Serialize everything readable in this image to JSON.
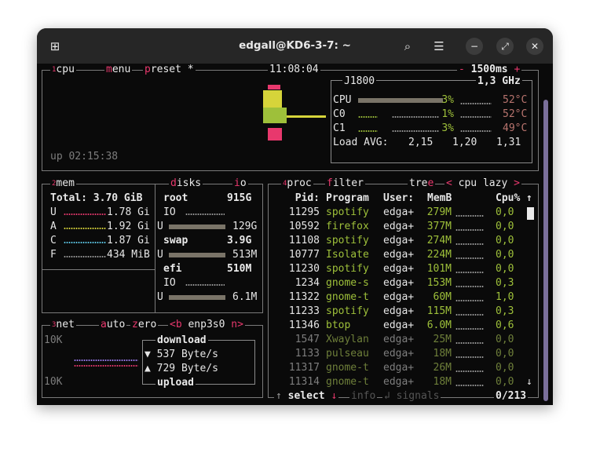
{
  "window": {
    "title": "edgall@KD6-3-7: ~"
  },
  "cpu": {
    "tab_num": "1",
    "tab_label": "cpu",
    "menu": "menu",
    "preset": "preset *",
    "clock": "11:08:04",
    "interval": "1500ms",
    "minus": "-",
    "plus": "+",
    "uptime": "up 02:15:38",
    "model": "J1800",
    "freq": "1,3 GHz",
    "cores": [
      {
        "name": "CPU",
        "pct": "3%",
        "temp": "52°C",
        "load": 0.03
      },
      {
        "name": "C0",
        "pct": "1%",
        "temp": "52°C",
        "load": 0.01
      },
      {
        "name": "C1",
        "pct": "3%",
        "temp": "49°C",
        "load": 0.03
      }
    ],
    "load_avg_label": "Load AVG:",
    "load_avg": [
      "2,15",
      "1,20",
      "1,31"
    ]
  },
  "mem": {
    "tab_num": "2",
    "tab_label": "mem",
    "total": "Total: 3.70 GiB",
    "rows": [
      {
        "key": "U",
        "value": "1.78 Gi",
        "color": "#e8386d"
      },
      {
        "key": "A",
        "value": "1.92 Gi",
        "color": "#d6d43a"
      },
      {
        "key": "C",
        "value": "1.87 Gi",
        "color": "#5ec8e8"
      },
      {
        "key": "F",
        "value": "434 MiB",
        "color": "#9a9a9a"
      }
    ]
  },
  "disks": {
    "tab_label": "disks",
    "io_label": "io",
    "items": [
      {
        "name": "root",
        "size": "915G",
        "io": "IO",
        "u": "U",
        "used": "129G",
        "fill": 0.14
      },
      {
        "name": "swap",
        "size": "3.9G",
        "u": "U",
        "used": "513M",
        "fill": 0.13
      },
      {
        "name": "efi",
        "size": "510M",
        "io": "IO",
        "u": "U",
        "used": "6.1M",
        "fill": 0.01
      }
    ]
  },
  "net": {
    "tab_num": "3",
    "tab_label": "net",
    "auto": "auto",
    "zero": "zero",
    "prev": "<b",
    "iface": "enp3s0",
    "next": "n>",
    "scale_top": "10K",
    "scale_bottom": "10K",
    "download_label": "download",
    "download": "▼ 537 Byte/s",
    "upload": "▲ 729 Byte/s",
    "upload_label": "upload"
  },
  "proc": {
    "tab_num": "4",
    "tab_label": "proc",
    "filter": "filter",
    "tree": "tree",
    "sort_prev": "<",
    "sort": "cpu lazy",
    "sort_next": ">",
    "headers": {
      "pid": "Pid:",
      "program": "Program",
      "user": "User:",
      "mem": "MemB",
      "cpu": "Cpu%",
      "arrow": "↑"
    },
    "rows": [
      {
        "pid": "11295",
        "program": "spotify",
        "user": "edga+",
        "mem": "279M",
        "cpu": "0,0"
      },
      {
        "pid": "10592",
        "program": "firefox",
        "user": "edga+",
        "mem": "377M",
        "cpu": "0,0"
      },
      {
        "pid": "11108",
        "program": "spotify",
        "user": "edga+",
        "mem": "274M",
        "cpu": "0,0"
      },
      {
        "pid": "10777",
        "program": "Isolate",
        "user": "edga+",
        "mem": "224M",
        "cpu": "0,0"
      },
      {
        "pid": "11230",
        "program": "spotify",
        "user": "edga+",
        "mem": "101M",
        "cpu": "0,0"
      },
      {
        "pid": "1234",
        "program": "gnome-s",
        "user": "edga+",
        "mem": "153M",
        "cpu": "0,3"
      },
      {
        "pid": "11322",
        "program": "gnome-t",
        "user": "edga+",
        "mem": "60M",
        "cpu": "1,0"
      },
      {
        "pid": "11233",
        "program": "spotify",
        "user": "edga+",
        "mem": "115M",
        "cpu": "0,3"
      },
      {
        "pid": "11346",
        "program": "btop",
        "user": "edga+",
        "mem": "6.0M",
        "cpu": "0,6"
      },
      {
        "pid": "1547",
        "program": "Xwaylan",
        "user": "edga+",
        "mem": "25M",
        "cpu": "0,0"
      },
      {
        "pid": "1133",
        "program": "pulseau",
        "user": "edga+",
        "mem": "18M",
        "cpu": "0,0"
      },
      {
        "pid": "11317",
        "program": "gnome-t",
        "user": "edga+",
        "mem": "26M",
        "cpu": "0,0"
      },
      {
        "pid": "11314",
        "program": "gnome-t",
        "user": "edga+",
        "mem": "18M",
        "cpu": "0,0"
      }
    ],
    "footer": {
      "up": "↑",
      "select": "select",
      "down": "↓",
      "info": "info",
      "enter": "↲",
      "signals": "signals",
      "count": "0/213",
      "scroll_down": "↓"
    }
  }
}
